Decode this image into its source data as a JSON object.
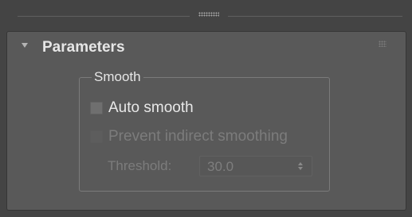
{
  "rollout": {
    "title": "Parameters",
    "collapse_icon": "triangle-down-icon",
    "grip_icon": "grip-dots-icon"
  },
  "group": {
    "title": "Smooth"
  },
  "auto_smooth": {
    "label": "Auto smooth",
    "checked": false,
    "enabled": true
  },
  "prevent_indirect": {
    "label": "Prevent indirect smoothing",
    "checked": false,
    "enabled": false
  },
  "threshold": {
    "label": "Threshold:",
    "value": "30.0",
    "enabled": false,
    "spinner_icon": "spinner-arrows-icon"
  }
}
